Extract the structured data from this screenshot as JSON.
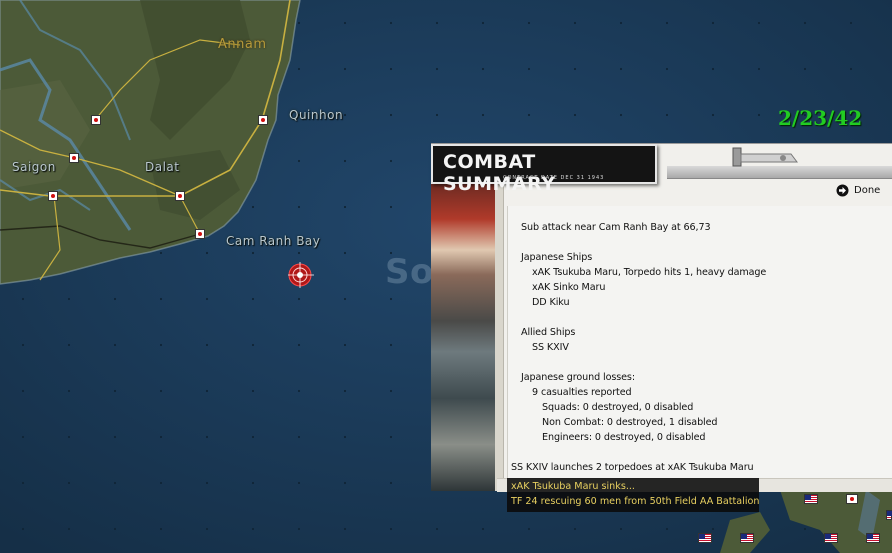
{
  "date": "2/23/42",
  "map": {
    "labels": {
      "annam": "Annam",
      "quinhon": "Quinhon",
      "saigon": "Saigon",
      "dalat": "Dalat",
      "cam_ranh_bay": "Cam Ranh Bay",
      "sea_partial": "So"
    }
  },
  "panel": {
    "title": "COMBAT SUMMARY",
    "subtitle": "CONTRACT DATE DEC 31 1943",
    "done_label": "Done",
    "lines": {
      "attack": "Sub attack near Cam Ranh Bay  at 66,73",
      "japanese_ships_header": "Japanese Ships",
      "jship1": "xAK Tsukuba Maru, Torpedo hits 1,  heavy damage",
      "jship2": "xAK Sinko Maru",
      "jship3": "DD Kiku",
      "allied_ships_header": "Allied Ships",
      "aship1": "SS KXIV",
      "ground_losses_header": "Japanese ground losses:",
      "casualties": "9 casualties reported",
      "squads": "Squads: 0 destroyed, 0 disabled",
      "noncombat": "Non Combat: 0 destroyed, 1 disabled",
      "engineers": "Engineers: 0 destroyed, 0 disabled",
      "launch": "SS KXIV launches 2 torpedoes at xAK Tsukuba Maru"
    }
  },
  "messages": {
    "line1": "xAK Tsukuba Maru sinks...",
    "line2": "TF 24 rescuing 60 men from 50th Field AA Battalion"
  },
  "icons": {
    "base": "japanese-base-icon",
    "us_flag": "us-flag-icon",
    "sub": "submarine-task-force-icon",
    "done": "done-arrow-icon"
  },
  "colors": {
    "date": "#22cc22",
    "message_text": "#e8d060",
    "sea": "#1b3a52",
    "land": "#4e5a3a"
  }
}
